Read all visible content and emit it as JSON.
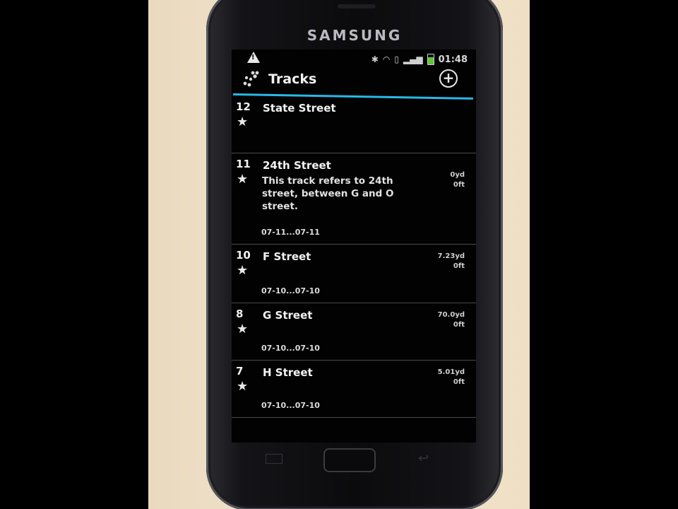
{
  "device": {
    "brand": "SAMSUNG"
  },
  "status_bar": {
    "time": "01:48",
    "icons": [
      "warning-icon",
      "bluetooth-icon",
      "wifi-icon",
      "sim-icon",
      "signal-icon",
      "battery-icon"
    ],
    "battery_color": "#5ec43b"
  },
  "app": {
    "title": "Tracks",
    "accent_color": "#2ab7e8",
    "add_label": "+"
  },
  "tracks": [
    {
      "number": "12",
      "name": "State Street",
      "description": "",
      "dates": "",
      "distance": "",
      "elevation": ""
    },
    {
      "number": "11",
      "name": "24th Street",
      "description": "This track refers to 24th street, between G and O street.",
      "dates": "07-11...07-11",
      "distance": "0yd",
      "elevation": "0ft"
    },
    {
      "number": "10",
      "name": "F Street",
      "description": "",
      "dates": "07-10...07-10",
      "distance": "7.23yd",
      "elevation": "0ft"
    },
    {
      "number": "8",
      "name": "G Street",
      "description": "",
      "dates": "07-10...07-10",
      "distance": "70.0yd",
      "elevation": "0ft"
    },
    {
      "number": "7",
      "name": "H Street",
      "description": "",
      "dates": "07-10...07-10",
      "distance": "5.01yd",
      "elevation": "0ft"
    }
  ]
}
